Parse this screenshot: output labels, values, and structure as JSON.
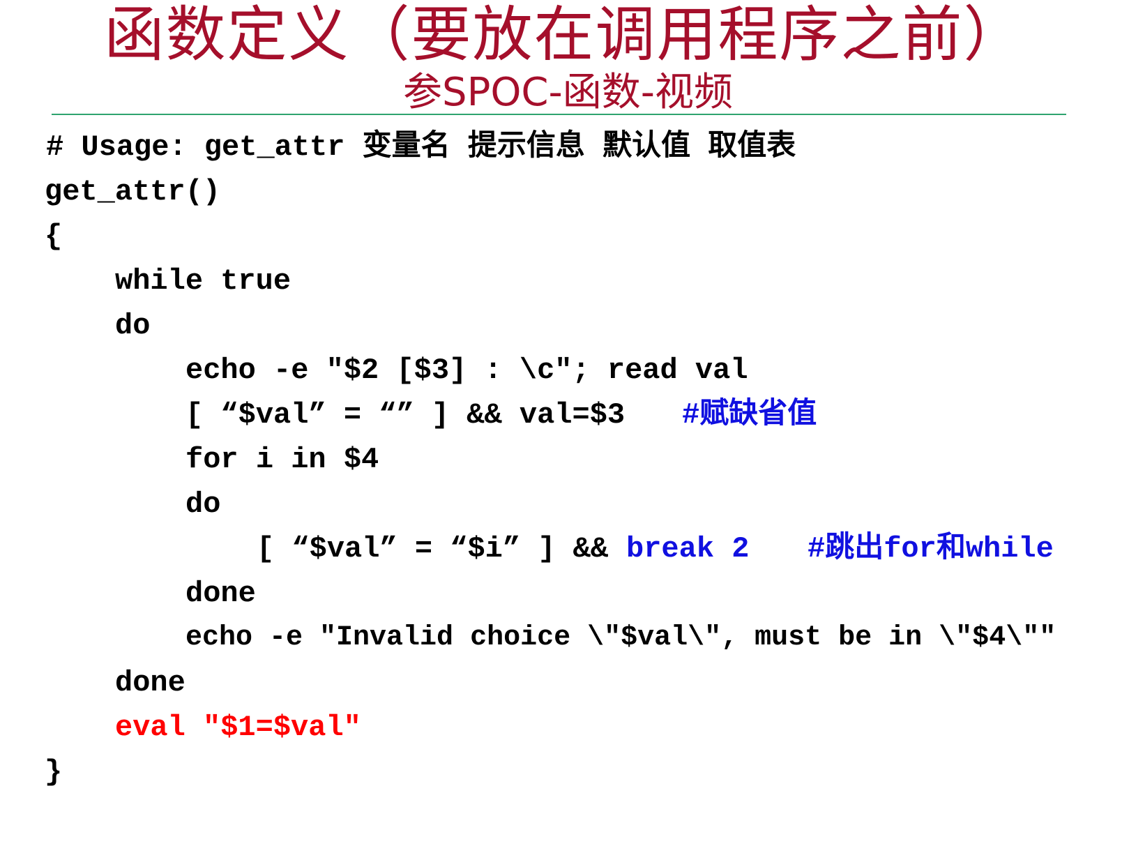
{
  "slide": {
    "title": "函数定义（要放在调用程序之前）",
    "subtitle": "参SPOC-函数-视频",
    "colors": {
      "title": "#a50f2b",
      "rule": "#2ea36e",
      "code": "#000000",
      "comment": "#1010e0",
      "highlight": "#ff0000"
    }
  },
  "code": {
    "usage_comment": "# Usage: get_attr 变量名 提示信息 默认值 取值表",
    "func_decl": "get_attr()",
    "open_brace": "{",
    "while_line": "while true",
    "do_outer": "do",
    "echo_prompt": "echo -e \"$2 [$3] : \\c\"; read val",
    "default_test": "[ “$val” = “” ] && val=$3",
    "default_comment": "#赋缺省值",
    "for_line": "for i in $4",
    "do_inner": "do",
    "match_test": "[ “$val” = “$i” ] &&",
    "break_stmt": "break 2",
    "break_comment": "#跳出for和while",
    "done_inner": "done",
    "echo_invalid": "echo -e \"Invalid choice \\\"$val\\\", must be in \\\"$4\\\"\"",
    "done_outer": "done",
    "eval_stmt": "eval \"$1=$val\"",
    "close_brace": "}"
  }
}
